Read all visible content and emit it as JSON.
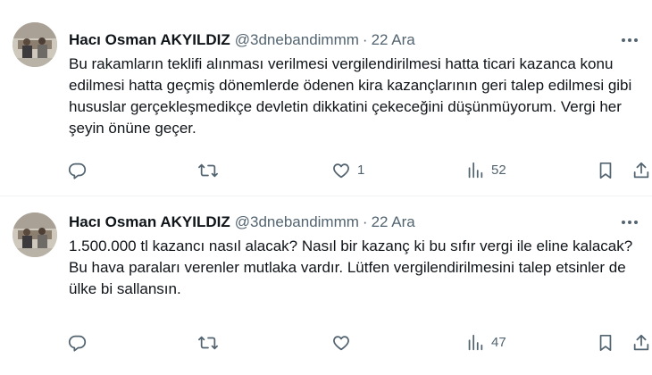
{
  "tweets": [
    {
      "author_name": "Hacı Osman AKYILDIZ",
      "handle": "@3dnebandimmm",
      "separator": "·",
      "time": "22 Ara",
      "text": "Bu rakamların teklifi alınması verilmesi vergilendirilmesi hatta ticari kazanca konu edilmesi hatta geçmiş dönemlerde ödenen kira kazançlarının geri talep edilmesi gibi hususlar gerçekleşmedikçe devletin dikkatini çekeceğini düşünmüyorum. Vergi her şeyin önüne geçer.",
      "replies": "",
      "retweets": "",
      "likes": "1",
      "views": "52"
    },
    {
      "author_name": "Hacı Osman AKYILDIZ",
      "handle": "@3dnebandimmm",
      "separator": "·",
      "time": "22 Ara",
      "text": "1.500.000 tl kazancı nasıl alacak? Nasıl bir kazanç ki bu sıfır vergi ile eline kalacak? Bu hava paraları verenler mutlaka vardır. Lütfen vergilendirilmesini talep etsinler de ülke bi sallansın.",
      "replies": "",
      "retweets": "",
      "likes": "",
      "views": "47"
    }
  ],
  "icons": {
    "more": "more-horizontal-icon",
    "reply": "reply-icon",
    "retweet": "retweet-icon",
    "like": "heart-icon",
    "views": "views-chart-icon",
    "bookmark": "bookmark-icon",
    "share": "share-icon"
  },
  "colors": {
    "text_primary": "#0f1419",
    "text_secondary": "#536471",
    "divider": "#eff3f4",
    "background": "#ffffff"
  }
}
